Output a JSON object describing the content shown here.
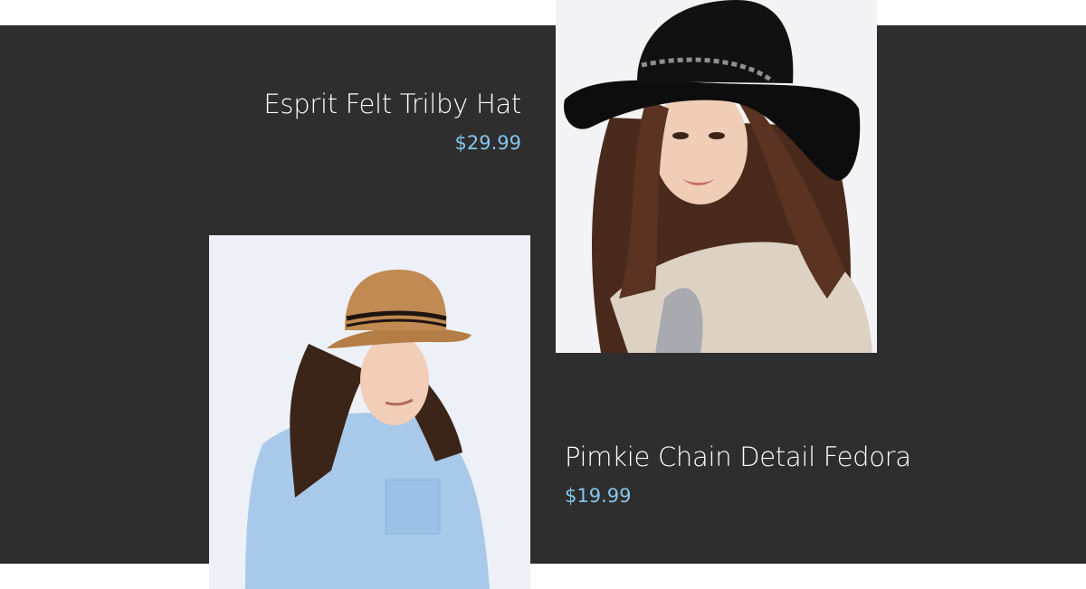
{
  "products": [
    {
      "name": "Esprit Felt Trilby Hat",
      "price": "$29.99",
      "image_icon": "woman-black-floppy-hat-photo"
    },
    {
      "name": "Pimkie Chain Detail Fedora",
      "price": "$19.99",
      "image_icon": "woman-tan-fedora-photo"
    }
  ],
  "colors": {
    "background": "#2e2e2e",
    "title": "#ffffff",
    "price": "#86c5ea"
  }
}
